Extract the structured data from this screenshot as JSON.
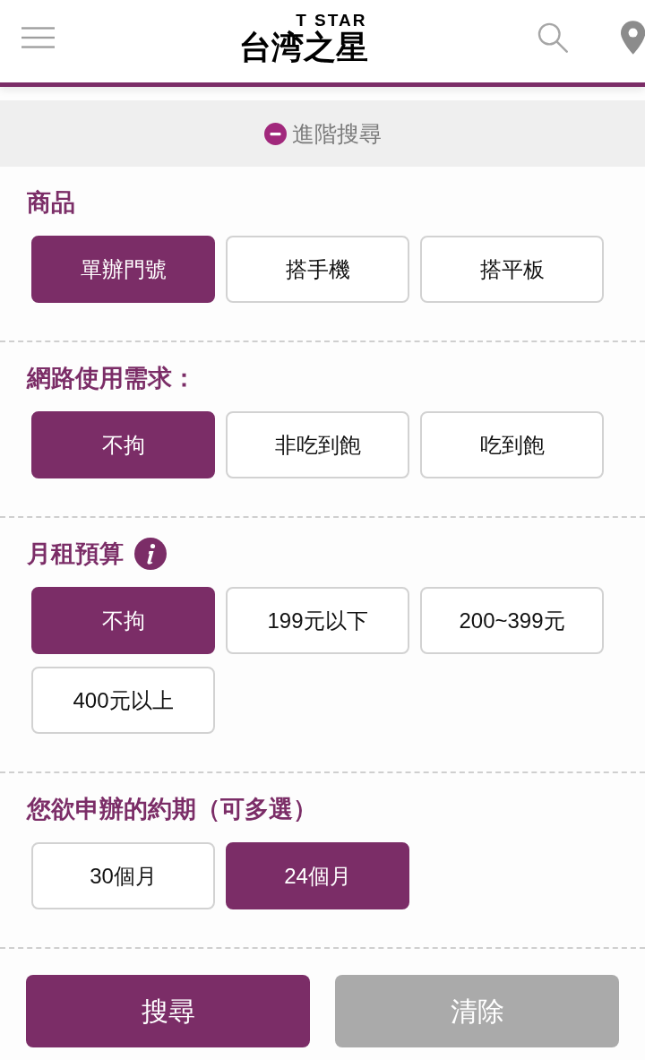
{
  "header": {
    "logo_subtitle": "T STAR",
    "logo_title": "台湾之星"
  },
  "advanced_search": {
    "label": "進階搜尋",
    "expanded": true
  },
  "sections": [
    {
      "title": "商品",
      "info": false,
      "options": [
        {
          "label": "單辦門號",
          "selected": true
        },
        {
          "label": "搭手機",
          "selected": false
        },
        {
          "label": "搭平板",
          "selected": false
        }
      ]
    },
    {
      "title": "網路使用需求：",
      "info": false,
      "options": [
        {
          "label": "不拘",
          "selected": true
        },
        {
          "label": "非吃到飽",
          "selected": false
        },
        {
          "label": "吃到飽",
          "selected": false
        }
      ]
    },
    {
      "title": "月租預算",
      "info": true,
      "options": [
        {
          "label": "不拘",
          "selected": true
        },
        {
          "label": "199元以下",
          "selected": false
        },
        {
          "label": "200~399元",
          "selected": false
        },
        {
          "label": "400元以上",
          "selected": false
        }
      ]
    },
    {
      "title": "您欲申辦的約期（可多選）",
      "info": false,
      "options": [
        {
          "label": "30個月",
          "selected": false
        },
        {
          "label": "24個月",
          "selected": true
        }
      ]
    }
  ],
  "actions": [
    {
      "label": "搜尋",
      "kind": "primary"
    },
    {
      "label": "清除",
      "kind": "secondary"
    }
  ]
}
